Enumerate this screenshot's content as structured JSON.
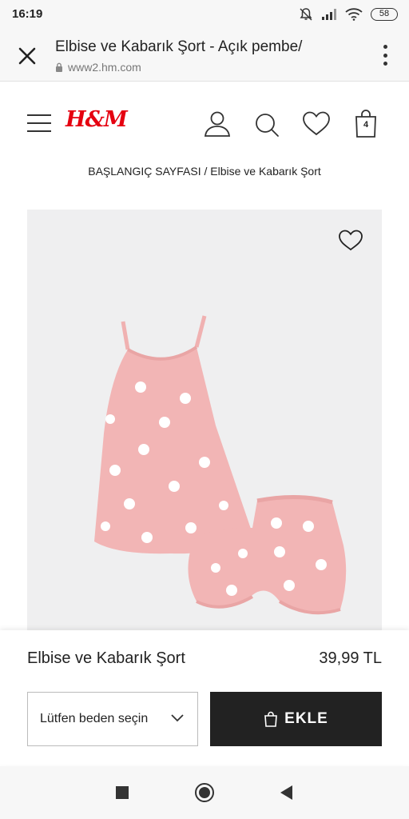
{
  "status_bar": {
    "time": "16:19",
    "battery": "58",
    "icons": [
      "mute-icon",
      "signal-icon",
      "wifi-icon",
      "battery-icon"
    ]
  },
  "browser": {
    "title": "Elbise ve Kabarık Şort - Açık pembe/",
    "url": "www2.hm.com",
    "icons": [
      "close-icon",
      "lock-icon",
      "more-vertical-icon"
    ]
  },
  "site_header": {
    "logo": "H&M",
    "bag_count": "4",
    "icons": [
      "menu-icon",
      "account-icon",
      "search-icon",
      "heart-icon",
      "shopping-bag-icon"
    ]
  },
  "breadcrumb": {
    "text": "BAŞLANGIÇ SAYFASI / Elbise ve Kabarık Şort"
  },
  "product": {
    "name": "Elbise ve Kabarık Şort",
    "price": "39,99 TL",
    "size_placeholder": "Lütfen beden seçin",
    "add_label": "EKLE",
    "image_icon": "favorite-heart-icon"
  },
  "colors": {
    "brand_red": "#e50010",
    "button_dark": "#222222",
    "garment_pink": "#f2b5b5"
  },
  "nav_bar": {
    "icons": [
      "recents-square-icon",
      "home-circle-icon",
      "back-triangle-icon"
    ]
  }
}
